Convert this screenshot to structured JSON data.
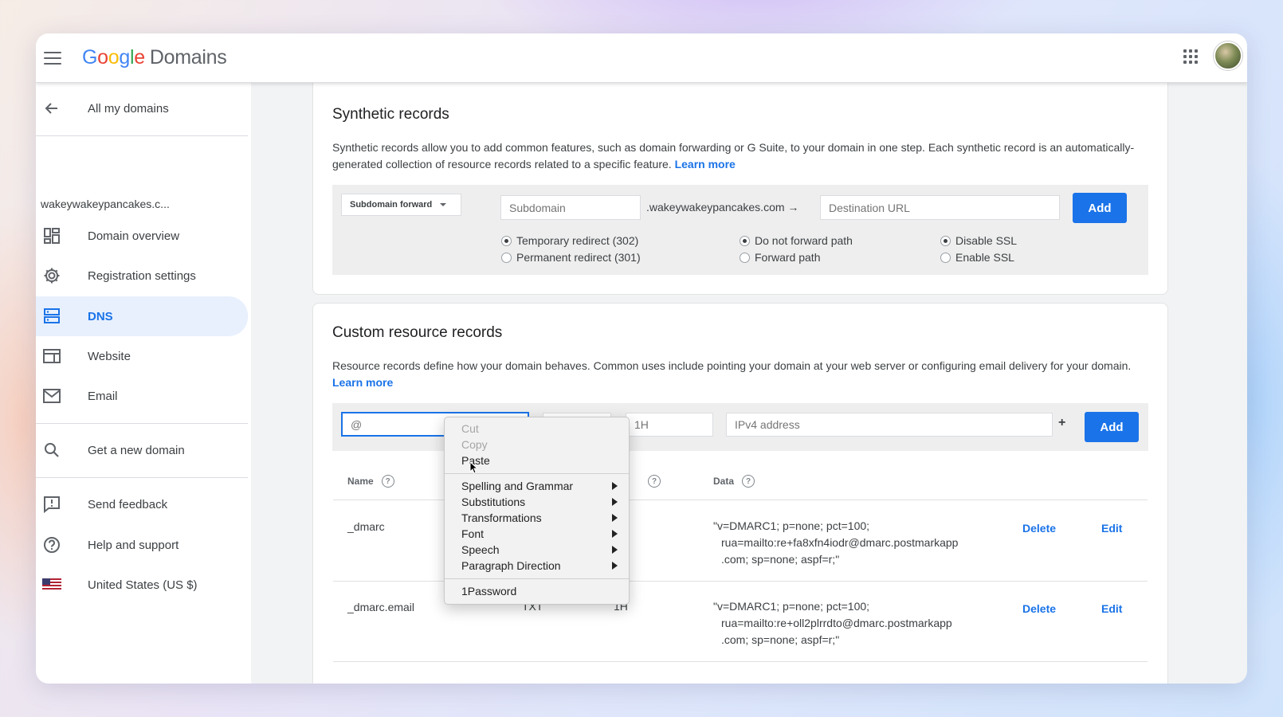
{
  "brand": {
    "logo_letters": [
      "G",
      "o",
      "o",
      "g",
      "l",
      "e"
    ],
    "product": "Domains"
  },
  "sidebar": {
    "back_label": "All my domains",
    "domain_name": "wakeywakeypancakes.c...",
    "items": [
      {
        "label": "Domain overview",
        "icon": "dashboard-icon"
      },
      {
        "label": "Registration settings",
        "icon": "gear-icon"
      },
      {
        "label": "DNS",
        "icon": "dns-icon",
        "active": true
      },
      {
        "label": "Website",
        "icon": "website-icon"
      },
      {
        "label": "Email",
        "icon": "mail-icon"
      }
    ],
    "get_domain_label": "Get a new domain",
    "footer_items": [
      {
        "label": "Send feedback",
        "icon": "feedback-icon"
      },
      {
        "label": "Help and support",
        "icon": "help-icon"
      },
      {
        "label": "United States (US $)",
        "icon": "us-flag-icon"
      }
    ]
  },
  "synthetic": {
    "title": "Synthetic records",
    "description": "Synthetic records allow you to add common features, such as domain forwarding or G Suite, to your domain in one step. Each synthetic record is an automatically-generated collection of resource records related to a specific feature.",
    "learn_more": "Learn more",
    "type_select": "Subdomain forward",
    "subdomain_placeholder": "Subdomain",
    "domain_suffix": ".wakeywakeypancakes.com →",
    "destination_placeholder": "Destination URL",
    "add_label": "Add",
    "redirect_options": [
      "Temporary redirect (302)",
      "Permanent redirect (301)"
    ],
    "path_options": [
      "Do not forward path",
      "Forward path"
    ],
    "ssl_options": [
      "Disable SSL",
      "Enable SSL"
    ]
  },
  "custom": {
    "title": "Custom resource records",
    "description": "Resource records define how your domain behaves. Common uses include pointing your domain at your web server or configuring email delivery for your domain.",
    "learn_more": "Learn more",
    "name_placeholder": "@",
    "ttl_placeholder": "1H",
    "data_placeholder": "IPv4 address",
    "plus": "+",
    "add_label": "Add",
    "columns": {
      "name": "Name",
      "data": "Data"
    },
    "rows": [
      {
        "name": "_dmarc",
        "data_lines": [
          "\"v=DMARC1; p=none; pct=100;",
          "rua=mailto:re+fa8xfn4iodr@dmarc.postmarkapp",
          ".com; sp=none; aspf=r;\""
        ],
        "delete": "Delete",
        "edit": "Edit"
      },
      {
        "name": "_dmarc.email",
        "type_partial": "TXT",
        "ttl_partial": "1H",
        "data_lines": [
          "\"v=DMARC1; p=none; pct=100;",
          "rua=mailto:re+oll2plrrdto@dmarc.postmarkapp",
          ".com; sp=none; aspf=r;\""
        ],
        "delete": "Delete",
        "edit": "Edit"
      }
    ]
  },
  "context_menu": {
    "items": [
      {
        "label": "Cut",
        "disabled": true
      },
      {
        "label": "Copy",
        "disabled": true
      },
      {
        "label": "Paste",
        "disabled": false
      },
      {
        "label": "Spelling and Grammar",
        "submenu": true
      },
      {
        "label": "Substitutions",
        "submenu": true
      },
      {
        "label": "Transformations",
        "submenu": true
      },
      {
        "label": "Font",
        "submenu": true
      },
      {
        "label": "Speech",
        "submenu": true
      },
      {
        "label": "Paragraph Direction",
        "submenu": true
      },
      {
        "label": "1Password",
        "submenu": false
      }
    ]
  },
  "colors": {
    "accent": "#1a73e8",
    "active_bg": "#e8f0fe"
  }
}
